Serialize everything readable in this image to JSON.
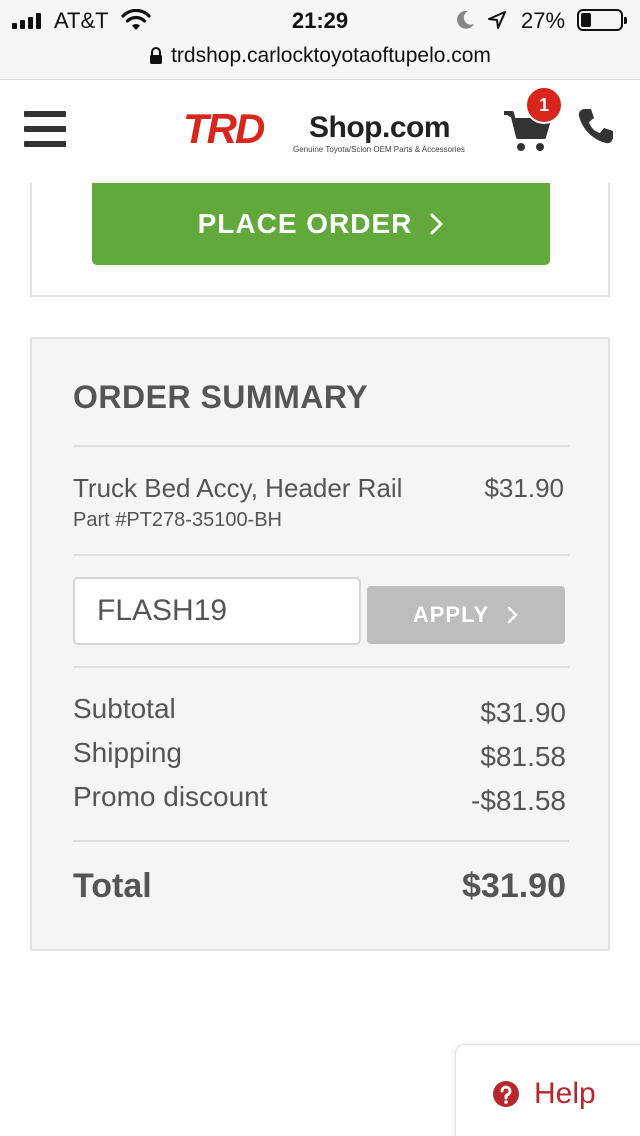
{
  "status_bar": {
    "carrier": "AT&T",
    "time": "21:29",
    "battery_percent": "27%",
    "battery_level": 0.27,
    "icons": [
      "signal-icon",
      "wifi-icon",
      "moon-icon",
      "location-arrow-icon",
      "battery-icon"
    ]
  },
  "browser": {
    "url": "trdshop.carlocktoyotaoftupelo.com",
    "icon": "lock-icon"
  },
  "header": {
    "logo_trd": "TRD",
    "logo_shop": "Shop.com",
    "logo_tagline": "Genuine Toyota/Scion OEM Parts & Accessories",
    "cart_count": "1",
    "icons": [
      "menu-icon",
      "cart-icon",
      "phone-icon"
    ],
    "brand_color": "#d9261c"
  },
  "checkout": {
    "place_order_label": "PLACE ORDER",
    "place_order_color": "#62a93b"
  },
  "order_summary": {
    "title": "ORDER SUMMARY",
    "item": {
      "name": "Truck Bed Accy, Header Rail",
      "part": "Part #PT278-35100-BH",
      "price": "$31.90"
    },
    "promo": {
      "value": "FLASH19",
      "apply_label": "APPLY"
    },
    "lines": [
      {
        "label": "Subtotal",
        "value": "$31.90"
      },
      {
        "label": "Shipping",
        "value": "$81.58"
      },
      {
        "label": "Promo discount",
        "value": "-$81.58"
      }
    ],
    "total_label": "Total",
    "total_value": "$31.90"
  },
  "help": {
    "label": "Help",
    "color": "#b8272c"
  }
}
